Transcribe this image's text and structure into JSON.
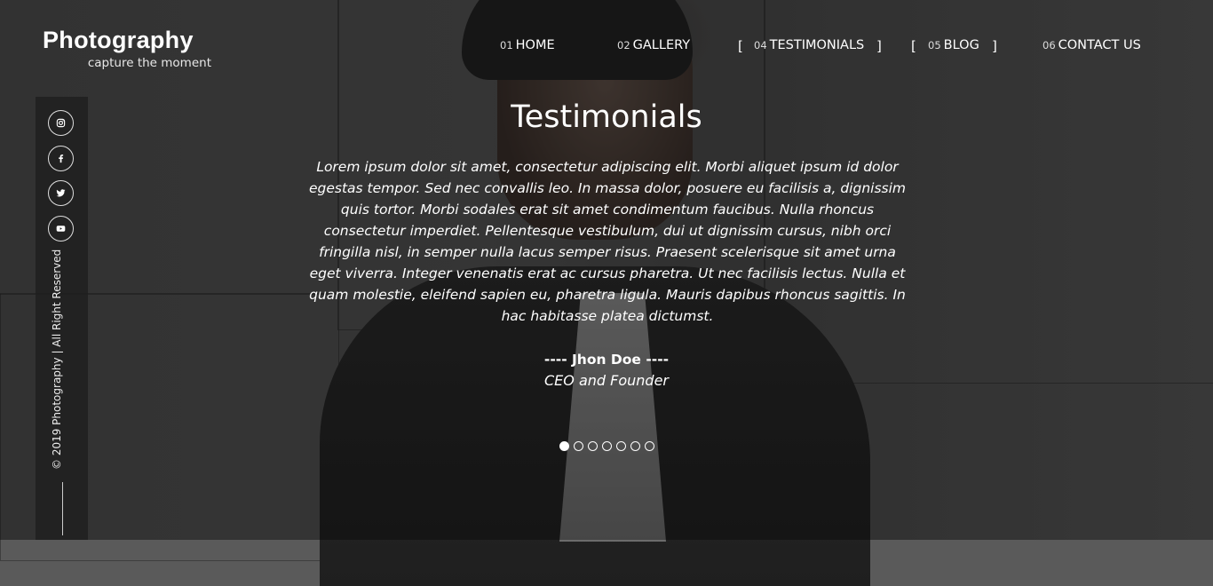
{
  "brand": {
    "name": "Photography",
    "tagline": "capture the moment"
  },
  "nav": [
    {
      "num": "01",
      "label": "HOME"
    },
    {
      "num": "02",
      "label": "GALLERY"
    },
    {
      "num": "04",
      "label": "TESTIMONIALS",
      "bracketed": true
    },
    {
      "num": "05",
      "label": "BLOG",
      "bracketed": true
    },
    {
      "num": "06",
      "label": "CONTACT US"
    }
  ],
  "social": [
    "instagram-icon",
    "facebook-icon",
    "twitter-icon",
    "youtube-icon"
  ],
  "footer": {
    "copyright": "© 2019 Photography | All Right Reserved"
  },
  "testimonial": {
    "title": "Testimonials",
    "quote": "Lorem ipsum dolor sit amet, consectetur adipiscing elit. Morbi aliquet ipsum id dolor egestas tempor. Sed nec convallis leo. In massa dolor, posuere eu facilisis a, dignissim quis tortor. Morbi sodales erat sit amet condimentum faucibus. Nulla rhoncus consectetur imperdiet. Pellentesque vestibulum, dui ut dignissim cursus, nibh orci fringilla nisl, in semper nulla lacus semper risus. Praesent scelerisque sit amet urna eget viverra. Integer venenatis erat ac cursus pharetra. Ut nec facilisis lectus. Nulla et quam molestie, eleifend sapien eu, pharetra ligula. Mauris dapibus rhoncus sagittis. In hac habitasse platea dictumst.",
    "author": "---- Jhon Doe ----",
    "role": "CEO and Founder"
  },
  "carousel": {
    "count": 7,
    "active_index": 0
  }
}
